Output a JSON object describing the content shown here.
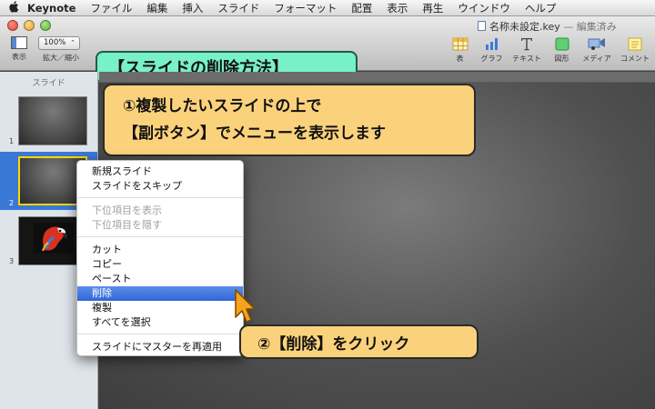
{
  "menubar": {
    "app_name": "Keynote",
    "items": [
      "ファイル",
      "編集",
      "挿入",
      "スライド",
      "フォーマット",
      "配置",
      "表示",
      "再生",
      "ウインドウ",
      "ヘルプ"
    ]
  },
  "window": {
    "doc_name": "名称未設定.key",
    "doc_status": "— 編集済み"
  },
  "toolbar": {
    "view_label": "表示",
    "zoom_value": "100%",
    "zoom_label": "拡大／縮小",
    "buttons": [
      {
        "label": "表",
        "icon": "table-icon"
      },
      {
        "label": "グラフ",
        "icon": "chart-icon"
      },
      {
        "label": "テキスト",
        "icon": "text-icon"
      },
      {
        "label": "図形",
        "icon": "shape-icon"
      },
      {
        "label": "メディア",
        "icon": "media-icon"
      },
      {
        "label": "コメント",
        "icon": "comment-icon"
      }
    ]
  },
  "banner": "【スライドの削除方法】",
  "sidebar": {
    "title": "スライド",
    "slides": [
      {
        "number": "1"
      },
      {
        "number": "2"
      },
      {
        "number": "3"
      }
    ]
  },
  "callouts": {
    "step1_line1": "①複製したいスライドの上で",
    "step1_line2": "【副ボタン】でメニューを表示します",
    "step2": "②【削除】をクリック"
  },
  "context_menu": {
    "items": [
      {
        "label": "新規スライド"
      },
      {
        "label": "スライドをスキップ"
      },
      {
        "label": "下位項目を表示"
      },
      {
        "label": "下位項目を隠す"
      },
      {
        "label": "カット"
      },
      {
        "label": "コピー"
      },
      {
        "label": "ペースト"
      },
      {
        "label": "削除"
      },
      {
        "label": "複製"
      },
      {
        "label": "すべてを選択"
      },
      {
        "label": "スライドにマスターを再適用"
      }
    ]
  },
  "colors": {
    "banner_bg": "#78f0c8",
    "callout_bg": "#fbd27c",
    "selection": "#3a78d6",
    "menu_highlight": "#2f66d6"
  }
}
